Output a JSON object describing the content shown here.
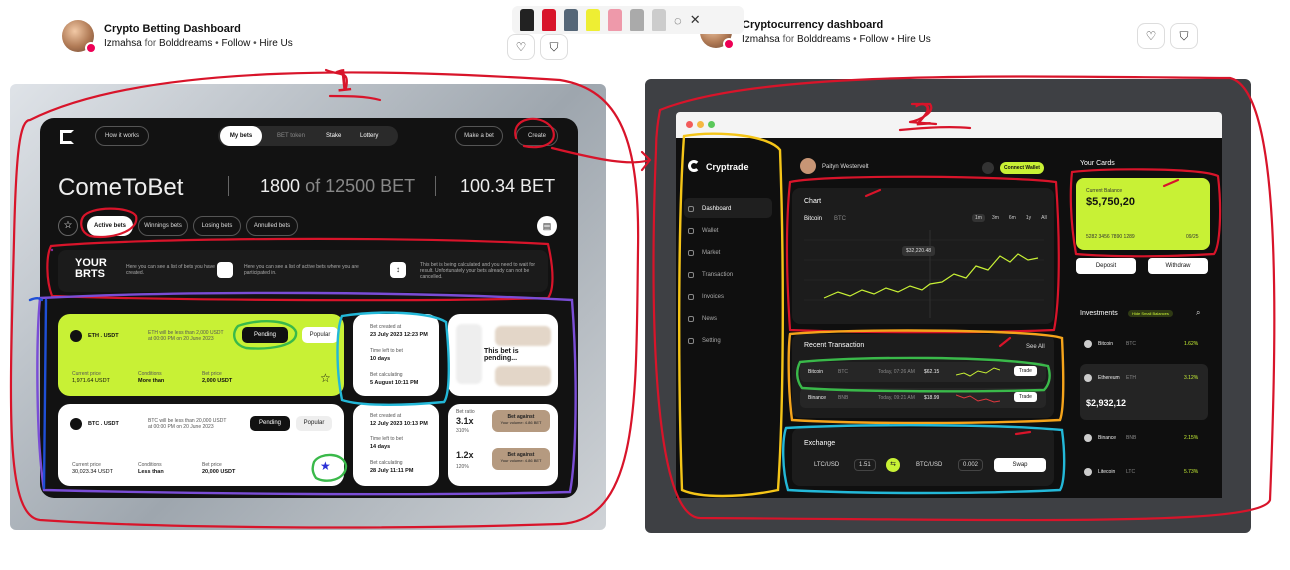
{
  "header_left": {
    "title": "Crypto Betting Dashboard",
    "author": "Izmahsa",
    "for_word": "for",
    "team": "Bolddreams",
    "follow": "Follow",
    "hire": "Hire Us"
  },
  "header_right": {
    "title": "Cryptocurrency dashboard",
    "author": "Izmahsa",
    "for_word": "for",
    "team": "Bolddreams",
    "follow": "Follow",
    "hire": "Hire Us"
  },
  "annotations": {
    "label_1": "1",
    "label_2": "2"
  },
  "bet_app": {
    "nav": {
      "how": "How it works",
      "mybets": "My bets",
      "bet_token": "BET token",
      "stake": "Stake",
      "lottery": "Lottery",
      "make_bet": "Make a bet",
      "create": "Create"
    },
    "hero": {
      "title": "ComeToBet",
      "count": "1800",
      "of": "of",
      "total": "12500 BET",
      "balance": "100.34 BET"
    },
    "tabs": {
      "active": "Active bets",
      "winning": "Winnings bets",
      "losing": "Losing bets",
      "annulled": "Annulled bets"
    },
    "info": {
      "heading": "YOUR BRTS",
      "text1": "Here you can see a list of bets you have created.",
      "text2": "Here you can see a list of active bets where you are participated in.",
      "text3": "This bet is being calculated and you need to wait for result. Unfortunately your bets already can not be cancelled."
    },
    "bet1": {
      "pair": "ETH . USDT",
      "desc": "ETH will be less than 2,000 USDT at 00:00 PM on 20 June 2023",
      "status": "Pending",
      "tag": "Popular",
      "cur_label": "Current price",
      "cur": "1,971.64 USDT",
      "cond_label": "Conditions",
      "cond": "More than",
      "bet_label": "Bet price",
      "bet": "2,000 USDT"
    },
    "bet2": {
      "pair": "BTC . USDT",
      "desc": "BTC will be less than 20,000 USDT at 00:00 PM on 20 June 2023",
      "status": "Pending",
      "tag": "Popular",
      "cur_label": "Current price",
      "cur": "30,023.34 USDT",
      "cond_label": "Conditions",
      "cond": "Less than",
      "bet_label": "Bet price",
      "bet": "20,000 USDT"
    },
    "time1": {
      "created_label": "Bet created at",
      "created": "23 July 2023 12:23 PM",
      "left_label": "Time left to bet",
      "left": "10 days",
      "calc_label": "Bet calculating",
      "calc": "5 August 10:11 PM"
    },
    "time2": {
      "created_label": "Bet created at",
      "created": "12 July 2023 10:13 PM",
      "left_label": "Time left to bet",
      "left": "14 days",
      "calc_label": "Bet calculating",
      "calc": "28 July 11:11 PM"
    },
    "pending_msg": "This bet is pending...",
    "odds2": {
      "label": "Bet ratio",
      "v1": "3.1x",
      "p1": "310%",
      "v2": "1.2x",
      "p2": "120%",
      "btn1": "Bet against",
      "btn1_sub": "Your volume: 4.86 BET",
      "btn2": "Bet against",
      "btn2_sub": "Your volume: 4.86 BET"
    }
  },
  "crypto_app": {
    "brand": "Cryptrade",
    "menu": [
      "Dashboard",
      "Wallet",
      "Market",
      "Transaction",
      "Invoices",
      "News",
      "Setting"
    ],
    "user": "Paityn Westervelt",
    "connect": "Connect Wallet",
    "chart": {
      "title": "Chart",
      "coin": "Bitcoin",
      "ticker": "BTC",
      "tooltip": "$32,220.48",
      "ranges": [
        "1m",
        "3m",
        "6m",
        "1y",
        "All"
      ]
    },
    "recent": {
      "title": "Recent Transaction",
      "see_all": "See All",
      "rows": [
        {
          "coin": "Bitcoin",
          "ticker": "BTC",
          "time": "Today, 07:26 AM",
          "amount": "$62.15",
          "action": "Trade"
        },
        {
          "coin": "Binance",
          "ticker": "BNB",
          "time": "Today, 09:21 AM",
          "amount": "$18.99",
          "action": "Trade"
        }
      ]
    },
    "exchange": {
      "title": "Exchange",
      "from": "LTC/USD",
      "from_val": "1.51",
      "to": "BTC/USD",
      "to_val": "0.002",
      "swap": "Swap"
    },
    "cards": {
      "title": "Your Cards",
      "balance_label": "Current Balance",
      "balance": "$5,750,20",
      "number": "5282 3456 7890 1289",
      "expiry": "09/25",
      "deposit": "Deposit",
      "withdraw": "Withdraw"
    },
    "investments": {
      "title": "Investments",
      "badge": "Hide Small Balances",
      "rows": [
        {
          "coin": "Bitcoin",
          "ticker": "BTC",
          "change": "1.62%"
        },
        {
          "coin": "Ethereum",
          "ticker": "ETH",
          "change": "3.12%",
          "value": "$2,932,12"
        },
        {
          "coin": "Binance",
          "ticker": "BNB",
          "change": "2.15%"
        },
        {
          "coin": "Litecoin",
          "ticker": "LTC",
          "change": "5.73%"
        }
      ]
    }
  },
  "colors": {
    "lime": "#c8f135",
    "ink": "#d8142a",
    "dark": "#121212"
  }
}
